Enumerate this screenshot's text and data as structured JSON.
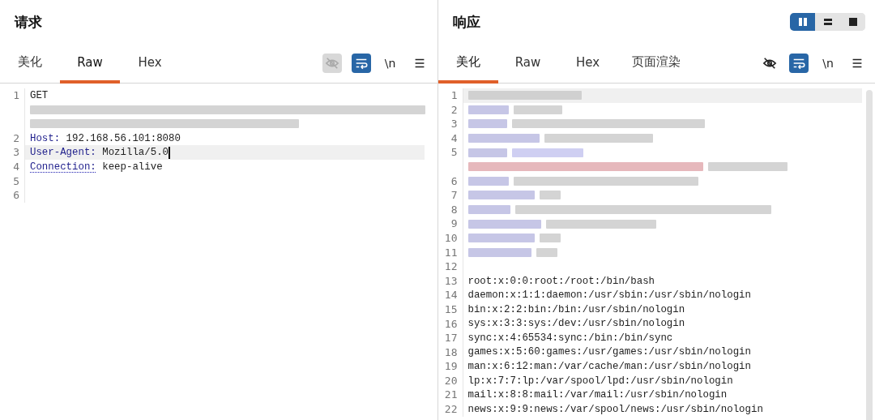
{
  "panels": [
    {
      "title": "请求",
      "tabs": [
        {
          "label": "美化",
          "selected": false
        },
        {
          "label": "Raw",
          "selected": true
        },
        {
          "label": "Hex",
          "selected": false
        }
      ],
      "tools": [
        {
          "kind": "eye",
          "on": true
        },
        {
          "kind": "wrap",
          "on": true
        },
        {
          "kind": "newline",
          "label": "\\n",
          "on": false
        },
        {
          "kind": "menu",
          "on": false
        }
      ],
      "lines": [
        {
          "number": "1",
          "highlighted": false,
          "segments": [
            {
              "kind": "text",
              "text": "GET"
            }
          ]
        },
        {
          "highlighted": false,
          "segments": [
            {
              "kind": "redacted",
              "color": "#d4d4d4"
            }
          ]
        },
        {
          "highlighted": false,
          "segments": [
            {
              "kind": "redacted",
              "color": "#d4d4d4"
            }
          ]
        },
        {
          "number": "2",
          "highlighted": false,
          "segments": [
            {
              "kind": "key",
              "text": "Host:"
            },
            {
              "kind": "text",
              "text": " 192.168.56.101:8080"
            }
          ]
        },
        {
          "number": "3",
          "highlighted": true,
          "cursor": true,
          "segments": [
            {
              "kind": "key",
              "text": "User-Agent:"
            },
            {
              "kind": "text",
              "text": " Mozilla/5.0"
            }
          ]
        },
        {
          "number": "4",
          "highlighted": false,
          "segments": [
            {
              "kind": "key",
              "text": "Connection:",
              "underlined": true
            },
            {
              "kind": "text",
              "text": " keep-alive"
            }
          ]
        },
        {
          "number": "5",
          "highlighted": false
        },
        {
          "number": "6",
          "highlighted": false
        }
      ]
    },
    {
      "title": "响应",
      "view_switch": [
        {
          "kind": "columns",
          "selected": true
        },
        {
          "kind": "rows",
          "selected": false
        },
        {
          "kind": "single",
          "selected": false
        }
      ],
      "tabs": [
        {
          "label": "美化",
          "selected": true
        },
        {
          "label": "Raw",
          "selected": false
        },
        {
          "label": "Hex",
          "selected": false
        },
        {
          "label": "页面渲染",
          "selected": false
        }
      ],
      "tools": [
        {
          "kind": "eye",
          "on": false
        },
        {
          "kind": "wrap",
          "on": true
        },
        {
          "kind": "newline",
          "label": "\\n",
          "on": false
        },
        {
          "kind": "menu",
          "on": false
        }
      ],
      "scrollbar": true,
      "lines": [
        {
          "number": "1",
          "highlighted": true,
          "segments": [
            {
              "kind": "redacted",
              "color": "#d0d0d0"
            }
          ]
        },
        {
          "number": "2",
          "highlighted": false,
          "segments": [
            {
              "kind": "redacted",
              "color": "#c6c6e6"
            },
            {
              "kind": "redacted",
              "color": "#d4d4d4"
            }
          ]
        },
        {
          "number": "3",
          "highlighted": false,
          "segments": [
            {
              "kind": "redacted",
              "color": "#c6c6e6"
            },
            {
              "kind": "redacted",
              "color": "#d4d4d4"
            }
          ]
        },
        {
          "number": "4",
          "highlighted": false,
          "segments": [
            {
              "kind": "redacted",
              "color": "#c6c6e6"
            },
            {
              "kind": "redacted",
              "color": "#d4d4d4"
            }
          ]
        },
        {
          "number": "5",
          "highlighted": false,
          "segments": [
            {
              "kind": "redacted",
              "color": "#c6c6e6"
            },
            {
              "kind": "redacted",
              "color": "#cfcff2"
            }
          ]
        },
        {
          "highlighted": false,
          "segments": [
            {
              "kind": "redacted",
              "color": "#e6b8bc"
            },
            {
              "kind": "redacted",
              "color": "#d4d4d4"
            }
          ]
        },
        {
          "number": "6",
          "highlighted": false,
          "segments": [
            {
              "kind": "redacted",
              "color": "#c6c6e6"
            },
            {
              "kind": "redacted",
              "color": "#d4d4d4"
            }
          ]
        },
        {
          "number": "7",
          "highlighted": false,
          "segments": [
            {
              "kind": "redacted",
              "color": "#c6c6e6"
            },
            {
              "kind": "redacted",
              "color": "#d4d4d4"
            }
          ]
        },
        {
          "number": "8",
          "highlighted": false,
          "segments": [
            {
              "kind": "redacted",
              "color": "#c6c6e6"
            },
            {
              "kind": "redacted",
              "color": "#d4d4d4"
            }
          ]
        },
        {
          "number": "9",
          "highlighted": false,
          "segments": [
            {
              "kind": "redacted",
              "color": "#c6c6e6"
            },
            {
              "kind": "redacted",
              "color": "#d4d4d4"
            }
          ]
        },
        {
          "number": "10",
          "highlighted": false,
          "segments": [
            {
              "kind": "redacted",
              "color": "#c6c6e6"
            },
            {
              "kind": "redacted",
              "color": "#d4d4d4"
            }
          ]
        },
        {
          "number": "11",
          "highlighted": false,
          "segments": [
            {
              "kind": "redacted",
              "color": "#c6c6e6"
            },
            {
              "kind": "redacted",
              "color": "#d4d4d4"
            }
          ]
        },
        {
          "number": "12",
          "highlighted": false
        },
        {
          "number": "13",
          "highlighted": false,
          "segments": [
            {
              "kind": "text",
              "text": "root:x:0:0:root:/root:/bin/bash"
            }
          ]
        },
        {
          "number": "14",
          "highlighted": false,
          "segments": [
            {
              "kind": "text",
              "text": "daemon:x:1:1:daemon:/usr/sbin:/usr/sbin/nologin"
            }
          ]
        },
        {
          "number": "15",
          "highlighted": false,
          "segments": [
            {
              "kind": "text",
              "text": "bin:x:2:2:bin:/bin:/usr/sbin/nologin"
            }
          ]
        },
        {
          "number": "16",
          "highlighted": false,
          "segments": [
            {
              "kind": "text",
              "text": "sys:x:3:3:sys:/dev:/usr/sbin/nologin"
            }
          ]
        },
        {
          "number": "17",
          "highlighted": false,
          "segments": [
            {
              "kind": "text",
              "text": "sync:x:4:65534:sync:/bin:/bin/sync"
            }
          ]
        },
        {
          "number": "18",
          "highlighted": false,
          "segments": [
            {
              "kind": "text",
              "text": "games:x:5:60:games:/usr/games:/usr/sbin/nologin"
            }
          ]
        },
        {
          "number": "19",
          "highlighted": false,
          "segments": [
            {
              "kind": "text",
              "text": "man:x:6:12:man:/var/cache/man:/usr/sbin/nologin"
            }
          ]
        },
        {
          "number": "20",
          "highlighted": false,
          "segments": [
            {
              "kind": "text",
              "text": "lp:x:7:7:lp:/var/spool/lpd:/usr/sbin/nologin"
            }
          ]
        },
        {
          "number": "21",
          "highlighted": false,
          "segments": [
            {
              "kind": "text",
              "text": "mail:x:8:8:mail:/var/mail:/usr/sbin/nologin"
            }
          ]
        },
        {
          "number": "22",
          "highlighted": false,
          "segments": [
            {
              "kind": "text",
              "text": "news:x:9:9:news:/var/spool/news:/usr/sbin/nologin"
            }
          ]
        }
      ]
    }
  ]
}
